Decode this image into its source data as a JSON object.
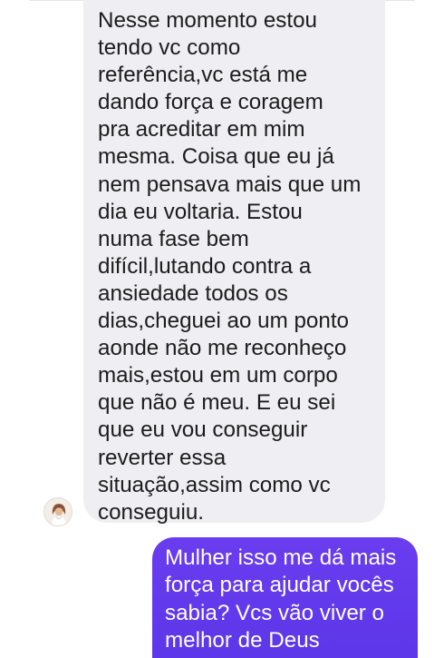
{
  "conversation": {
    "incoming_message": {
      "text": "Nesse momento estou\ntendo vc como\nreferência,vc está me\ndando força e coragem\npra acreditar em mim\nmesma.  Coisa que eu já\nnem pensava mais que um\ndia eu voltaria. Estou\nnuma fase bem\ndifícil,lutando contra a\nansiedade todos os\ndias,cheguei ao um ponto\naonde não me reconheço\nmais,estou em um corpo\nque não é meu. E eu sei\nque eu vou conseguir\nreverter essa\nsituação,assim como vc\nconseguiu.",
      "sender_avatar_icon": "avatar-photo-icon"
    },
    "outgoing_message": {
      "text": "Mulher isso me dá mais\nforça para ajudar vocês\nsabia? Vcs vão viver o\nmelhor de Deus"
    }
  },
  "colors": {
    "incoming_bubble": "#efeff3",
    "incoming_text": "#1c1c1e",
    "outgoing_bubble": "#5b36e8",
    "outgoing_text": "#ffffff",
    "background": "#ffffff"
  }
}
